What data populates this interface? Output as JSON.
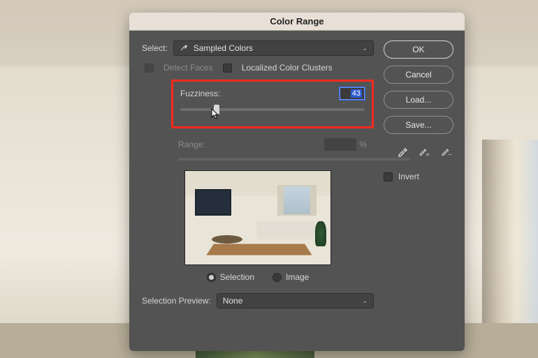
{
  "dialog": {
    "title": "Color Range",
    "select_label": "Select:",
    "select_value": "Sampled Colors",
    "detect_faces_label": "Detect Faces",
    "localized_clusters_label": "Localized Color Clusters",
    "fuzziness_label": "Fuzziness:",
    "fuzziness_value": "43",
    "range_label": "Range:",
    "range_unit": "%",
    "radio_selection": "Selection",
    "radio_image": "Image",
    "selection_preview_label": "Selection Preview:",
    "selection_preview_value": "None",
    "invert_label": "Invert"
  },
  "buttons": {
    "ok": "OK",
    "cancel": "Cancel",
    "load": "Load...",
    "save": "Save..."
  }
}
